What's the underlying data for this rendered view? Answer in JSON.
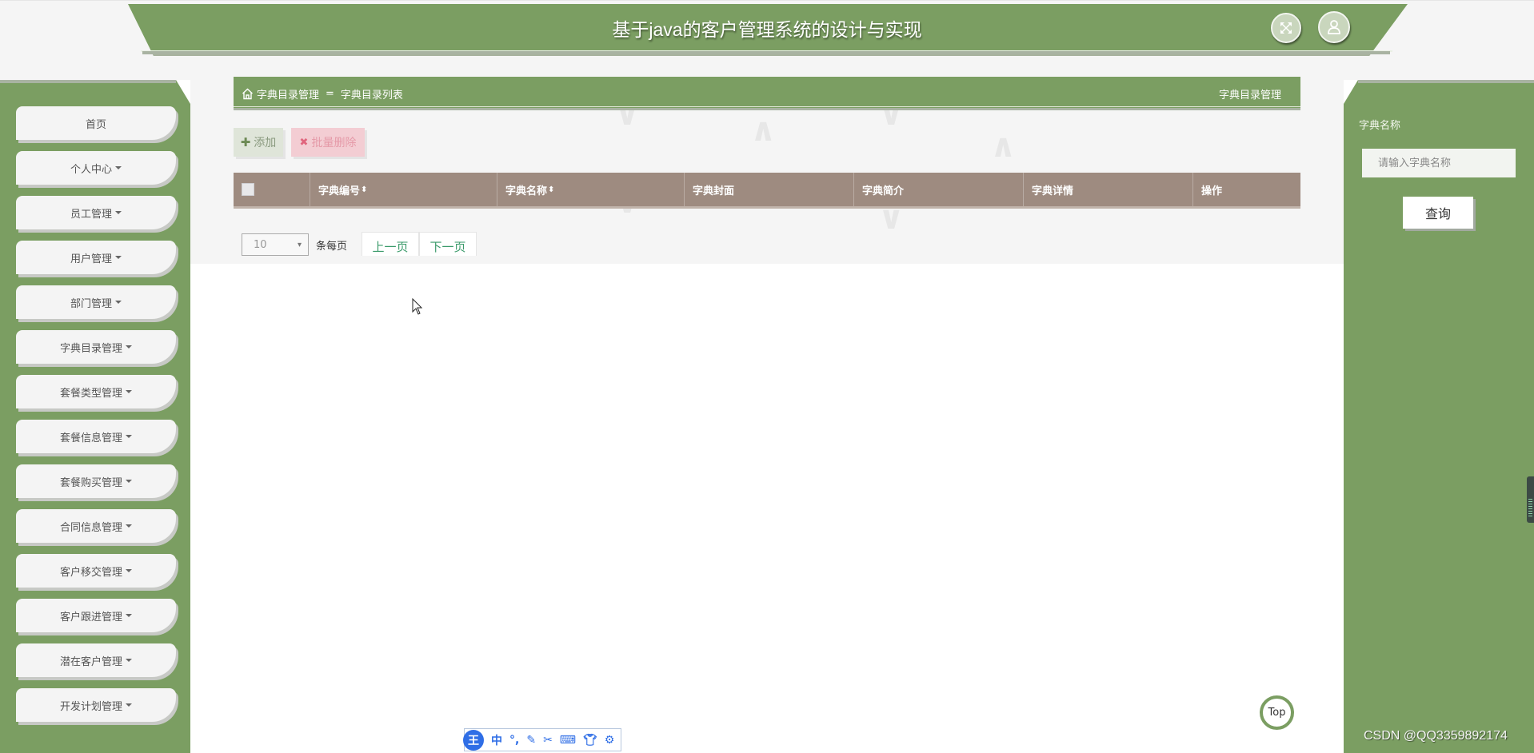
{
  "header": {
    "title": "基于java的客户管理系统的设计与实现",
    "fullscreen_icon": "fullscreen-icon",
    "user_icon": "user-icon"
  },
  "sidebar": {
    "items": [
      {
        "label": "首页",
        "has_dropdown": false
      },
      {
        "label": "个人中心",
        "has_dropdown": true
      },
      {
        "label": "员工管理",
        "has_dropdown": true
      },
      {
        "label": "用户管理",
        "has_dropdown": true
      },
      {
        "label": "部门管理",
        "has_dropdown": true
      },
      {
        "label": "字典目录管理",
        "has_dropdown": true
      },
      {
        "label": "套餐类型管理",
        "has_dropdown": true
      },
      {
        "label": "套餐信息管理",
        "has_dropdown": true
      },
      {
        "label": "套餐购买管理",
        "has_dropdown": true
      },
      {
        "label": "合同信息管理",
        "has_dropdown": true
      },
      {
        "label": "客户移交管理",
        "has_dropdown": true
      },
      {
        "label": "客户跟进管理",
        "has_dropdown": true
      },
      {
        "label": "潜在客户管理",
        "has_dropdown": true
      },
      {
        "label": "开发计划管理",
        "has_dropdown": true
      }
    ]
  },
  "breadcrumb": {
    "home_icon": "home-icon",
    "parent": "字典目录管理",
    "separator": "=",
    "current": "字典目录列表",
    "right_title": "字典目录管理"
  },
  "actions": {
    "add_label": "添加",
    "batch_delete_label": "批量删除"
  },
  "table": {
    "columns": [
      {
        "label": "",
        "type": "checkbox"
      },
      {
        "label": "字典编号",
        "sortable": true
      },
      {
        "label": "字典名称",
        "sortable": true
      },
      {
        "label": "字典封面",
        "sortable": false
      },
      {
        "label": "字典简介",
        "sortable": false
      },
      {
        "label": "字典详情",
        "sortable": false
      },
      {
        "label": "操作",
        "sortable": false
      }
    ],
    "rows": []
  },
  "pagination": {
    "page_size": "10",
    "per_page_label": "条每页",
    "prev_label": "上一页",
    "next_label": "下一页"
  },
  "search_panel": {
    "label": "字典名称",
    "input_value": "",
    "input_placeholder": "请输入字典名称",
    "search_label": "查询"
  },
  "misc": {
    "top_label": "Top",
    "watermark": "CSDN @QQ3359892174"
  },
  "ime_toolbar": {
    "logo": "王",
    "lang": "中",
    "items": [
      "punctuation-icon",
      "pen-icon",
      "scissors-icon",
      "keyboard-icon",
      "skin-icon",
      "settings-icon"
    ]
  },
  "colors": {
    "primary_green": "#7b9e62",
    "table_header": "#9e8b80",
    "add_button_bg": "#dfe5d9",
    "delete_button_bg": "#f3cdd3",
    "pager_link": "#3a9a6a"
  }
}
